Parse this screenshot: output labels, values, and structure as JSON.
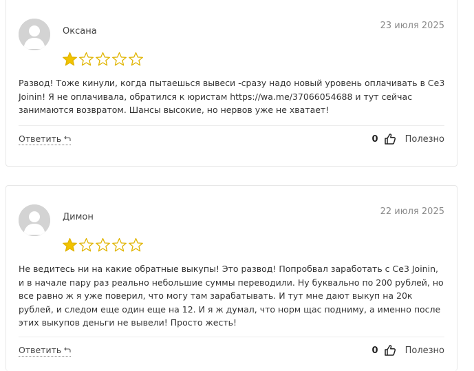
{
  "reviews": [
    {
      "author": "Оксана",
      "date": "23 июля 2025",
      "rating": 1,
      "max_rating": 5,
      "text": "Развод! Тоже кинули, когда пытаешься вывеси -сразу надо новый уровень оплачивать в Се3 Joinin! Я не оплачивала, обратился к юристам https://wa.me/37066054688 и тут сейчас занимаются возвратом. Шансы высокие, но нервов уже не хватает!",
      "reply_label": "Ответить",
      "helpful_count": "0",
      "helpful_label": "Полезно"
    },
    {
      "author": "Димон",
      "date": "22 июля 2025",
      "rating": 1,
      "max_rating": 5,
      "text": "Не ведитесь ни на какие обратные выкупы! Это развод! Попробвал заработать с Се3 Joinin, и в начале пару раз реально небольшие суммы переводили. Ну буквально по 200 рублей, но все равно ж я уже поверил, что могу там зарабатывать. И тут мне дают выкуп на 20к рублей, и следом еще один еще на 12. И я ж думал, что норм щас подниму, а именно после этих выкупов деньги не вывели! Просто жесть!",
      "reply_label": "Ответить",
      "helpful_count": "0",
      "helpful_label": "Полезно"
    }
  ],
  "colors": {
    "star_filled": "#f2c300",
    "star_outline": "#e0b400",
    "avatar_bg": "#d3d3d3",
    "avatar_fg": "#ffffff"
  },
  "icons": {
    "avatar": "user-silhouette-icon",
    "star": "star-icon",
    "reply": "reply-arrow-icon",
    "like": "thumbs-up-icon"
  }
}
